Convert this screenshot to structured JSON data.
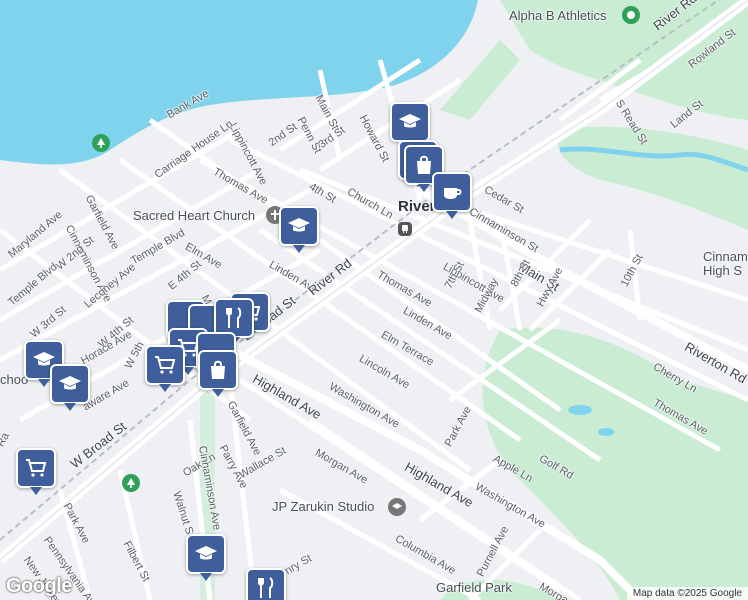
{
  "colors": {
    "water": "#7fd3ec",
    "land": "#eef0f3",
    "park": "#c9ecd3",
    "road": "#ffffff",
    "major_road": "#ffffff",
    "pin": "#3e5f9c",
    "park_poi": "#2fa15a"
  },
  "places": {
    "alpha_b": "Alpha B Athletics",
    "sacred_heart": "Sacred Heart Church",
    "riverton": "Riverto",
    "cinnaminson_high": "Cinnam High S",
    "jp_zarukin": "JP Zarukin Studio",
    "garfield_park": "Garfield Park",
    "school": "choo"
  },
  "streets": {
    "river_rd_ne": "River Rd",
    "river_rd": "River Rd",
    "rowland": "Rowland St",
    "s_read": "S Read St",
    "land": "Land St",
    "bank": "Bank Ave",
    "main_n": "Main St",
    "howard": "Howard St",
    "penn": "Penn St",
    "third": "3rd St",
    "second": "2nd St",
    "lippincott_n": "Lippincott Ave",
    "carriage": "Carriage House Ln",
    "thomas_n": "Thomas Ave",
    "fourth": "4th St",
    "church": "Church Ln",
    "cedar": "Cedar St",
    "cinnaminson_st": "Cinnaminson St",
    "garfield_n": "Garfield Ave",
    "cinnaminson_av": "Cinnaminson Ave",
    "maryland": "Maryland Ave",
    "w2nd": "W 2nd St",
    "temple_blvd": "Temple Blvd",
    "temple_blvd2": "Temple Blvd",
    "elm_n": "Elm Ave",
    "leconey": "Leconey Ave",
    "w3rd": "W 3rd St",
    "w4th": "W 4th St",
    "e4th": "E 4th St",
    "linden_n": "Linden Ave",
    "main_e": "Main St",
    "lippincott_e": "Lippincott Ave",
    "thomas_mid": "Thomas Ave",
    "seventh": "7th St",
    "eighth": "8th St",
    "midway": "Midway",
    "hwy": "Hwy Ave",
    "tenth": "10th St",
    "riverton_rd": "Riverton Rd",
    "cherry": "Cherry Ln",
    "thomas_e": "Thomas Ave",
    "linden_mid": "Linden Ave",
    "elm_terr": "Elm Terrace",
    "lincoln": "Lincoln Ave",
    "washington_n": "Washington Ave",
    "e_broad": "E Broad St",
    "w_broad": "W Broad St",
    "highland": "Highland Ave",
    "highland2": "Highland Ave",
    "horace": "Horace Ave",
    "w5th": "W 5th",
    "delaware": "aware Ave",
    "park_av": "Park Ave",
    "apple": "Apple Ln",
    "golf": "Golf Rd",
    "washington_s": "Washington Ave",
    "morgan": "Morgan Ave",
    "morgan2": "Morgan",
    "garfield_s": "Garfield Ave",
    "parry": "Parry Ave",
    "wallace": "Wallace St",
    "oak": "Oak Ln",
    "walnut": "Walnut St",
    "cinnaminson_s": "Cinnaminson Ave",
    "filbert": "Filbert St",
    "park_av2": "Park Ave",
    "pennsylvania": "Pennsylvania Ave",
    "new_jersey": "New Jersey Ave",
    "columbia": "Columbia Ave",
    "purnell": "Purnell Ave",
    "henry": "nry St",
    "mo": "Mo",
    "ra": "Ra"
  },
  "pins": [
    {
      "name": "school-pin-howard",
      "icon": "school-icon"
    },
    {
      "name": "shopping-pin-church",
      "icon": "shopping-bag-icon"
    },
    {
      "name": "cafe-pin-riverton",
      "icon": "coffee-cup-icon"
    },
    {
      "name": "school-pin-sacred-heart",
      "icon": "school-icon"
    },
    {
      "name": "grocery-pin-broad",
      "icon": "shopping-cart-icon"
    },
    {
      "name": "restaurant-pin-broad",
      "icon": "restaurant-icon"
    },
    {
      "name": "grocery-pin-broad-2",
      "icon": "shopping-cart-icon"
    },
    {
      "name": "shopping-pin-broad",
      "icon": "shopping-bag-icon"
    },
    {
      "name": "school-pin-west",
      "icon": "school-icon"
    },
    {
      "name": "school-pin-west-2",
      "icon": "school-icon"
    },
    {
      "name": "grocery-pin-sw",
      "icon": "shopping-cart-icon"
    },
    {
      "name": "school-pin-south",
      "icon": "school-icon"
    },
    {
      "name": "restaurant-pin-south",
      "icon": "restaurant-icon"
    }
  ],
  "footer": {
    "logo": "Google",
    "attribution": "Map data ©2025 Google"
  }
}
